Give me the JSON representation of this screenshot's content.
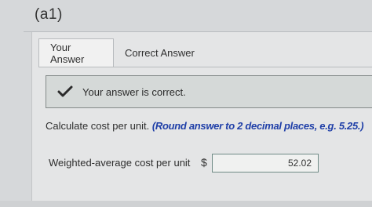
{
  "part_label": "(a1)",
  "tabs": [
    {
      "label": "Your Answer",
      "active": true
    },
    {
      "label": "Correct Answer",
      "active": false
    }
  ],
  "feedback": {
    "icon": "check-icon",
    "text": "Your answer is correct.",
    "accent_color": "#2b2b2b"
  },
  "question": {
    "text": "Calculate cost per unit.",
    "hint": "(Round answer to 2 decimal places, e.g. 5.25.)",
    "hint_color": "#1f3fa8"
  },
  "answer_row": {
    "label": "Weighted-average cost per unit",
    "currency": "$",
    "value": "52.02"
  }
}
